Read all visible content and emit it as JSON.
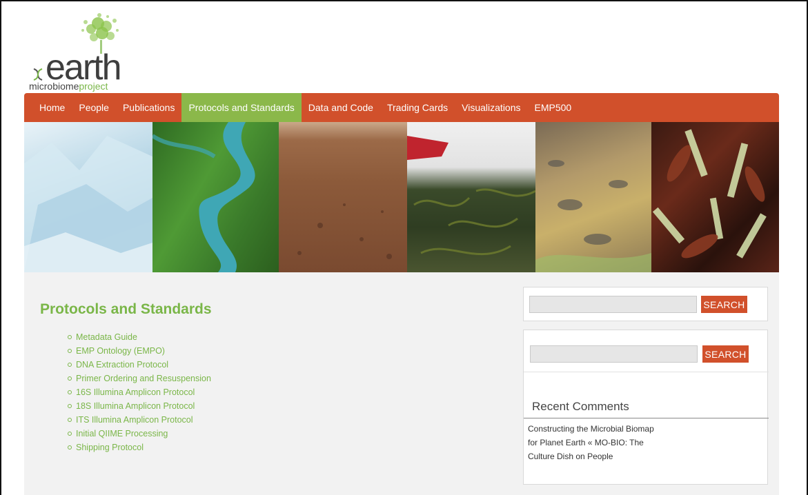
{
  "logo": {
    "word": "earth",
    "sub_part1": "microbiome",
    "sub_part2": "project"
  },
  "nav": {
    "items": [
      {
        "label": "Home"
      },
      {
        "label": "People"
      },
      {
        "label": "Publications"
      },
      {
        "label": "Protocols and Standards"
      },
      {
        "label": "Data and Code"
      },
      {
        "label": "Trading Cards"
      },
      {
        "label": "Visualizations"
      },
      {
        "label": "EMP500"
      }
    ],
    "active_index": 3
  },
  "main": {
    "title": "Protocols and Standards",
    "links": [
      "Metadata Guide",
      "EMP Ontology (EMPO)",
      "DNA Extraction Protocol",
      "Primer Ordering and Resuspension",
      "16S Illumina Amplicon Protocol",
      "18S Illumina Amplicon Protocol",
      "ITS Illumina Amplicon Protocol",
      "Initial QIIME Processing",
      "Shipping Protocol"
    ]
  },
  "sidebar": {
    "search1": {
      "button": "SEARCH",
      "value": ""
    },
    "search2": {
      "button": "SEARCH",
      "value": ""
    },
    "recent_comments": {
      "title": "Recent Comments",
      "comment_link": "Constructing the Microbial Biomap for Planet Earth « MO-BIO: The Culture Dish",
      "on_word": "on",
      "post_link": "People"
    }
  },
  "colors": {
    "nav_bg": "#d1502b",
    "nav_active": "#8bb84a",
    "link_green": "#7ab648",
    "button_bg": "#d1502b"
  }
}
